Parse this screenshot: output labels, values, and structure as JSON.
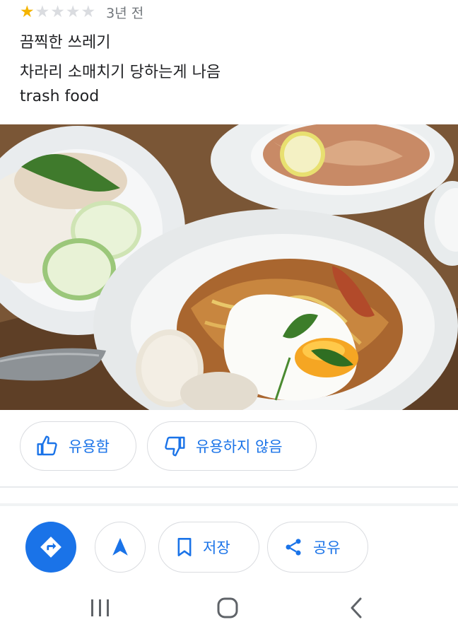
{
  "review": {
    "rating": 1,
    "max_rating": 5,
    "time_ago": "3년 전",
    "lines": [
      "끔찍한 쓰레기",
      "차라리 소매치기 당하는게 나음",
      "trash food"
    ]
  },
  "photo": {
    "description_icon": "food-photo"
  },
  "feedback": {
    "useful_label": "유용함",
    "not_useful_label": "유용하지 않음"
  },
  "actions": {
    "directions_icon": "directions-icon",
    "navigate_icon": "navigation-arrow-icon",
    "save_label": "저장",
    "share_label": "공유"
  },
  "colors": {
    "accent": "#1a73e8",
    "star": "#f4b400",
    "border": "#dadce0"
  }
}
